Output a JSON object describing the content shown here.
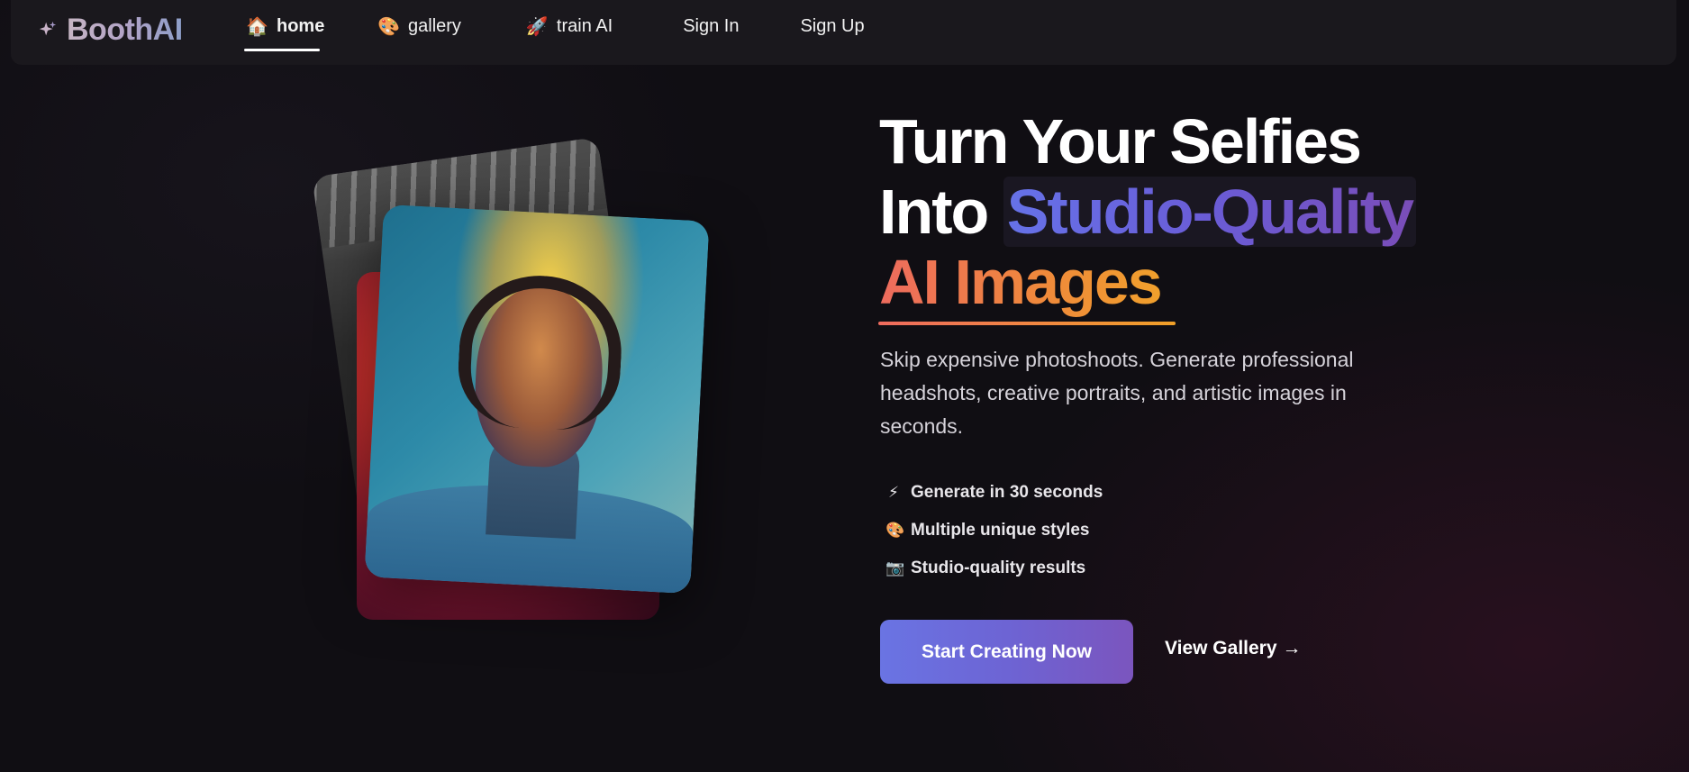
{
  "nav": {
    "brand": "BoothAI",
    "items": [
      {
        "icon": "house-icon",
        "glyph": "🏠",
        "label": "home",
        "active": true
      },
      {
        "icon": "palette-icon",
        "glyph": "🎨",
        "label": "gallery",
        "active": false
      },
      {
        "icon": "rocket-icon",
        "glyph": "🚀",
        "label": "train AI",
        "active": false
      }
    ],
    "sign_in": "Sign In",
    "sign_up": "Sign Up"
  },
  "hero": {
    "headline_line1": "Turn Your Selfies",
    "headline_into": "Into",
    "headline_highlight": "Studio-Quality",
    "headline_line3": "AI Images",
    "subtitle": "Skip expensive photoshoots. Generate professional headshots, creative portraits, and artistic images in seconds.",
    "features": [
      {
        "icon": "lightning-icon",
        "glyph": "⚡",
        "text": "Generate in 30 seconds"
      },
      {
        "icon": "palette-icon",
        "glyph": "🎨",
        "text": "Multiple unique styles"
      },
      {
        "icon": "camera-icon",
        "glyph": "📷",
        "text": "Studio-quality results"
      }
    ],
    "cta_primary": "Start Creating Now",
    "cta_secondary": "View Gallery",
    "cta_secondary_arrow": "→"
  },
  "colors": {
    "background": "#100e13",
    "navbar": "#1a181d",
    "primary_gradient_start": "#6a74e3",
    "primary_gradient_end": "#7b55be",
    "accent_orange_start": "#ed6b5e",
    "accent_orange_end": "#f0a02c"
  }
}
